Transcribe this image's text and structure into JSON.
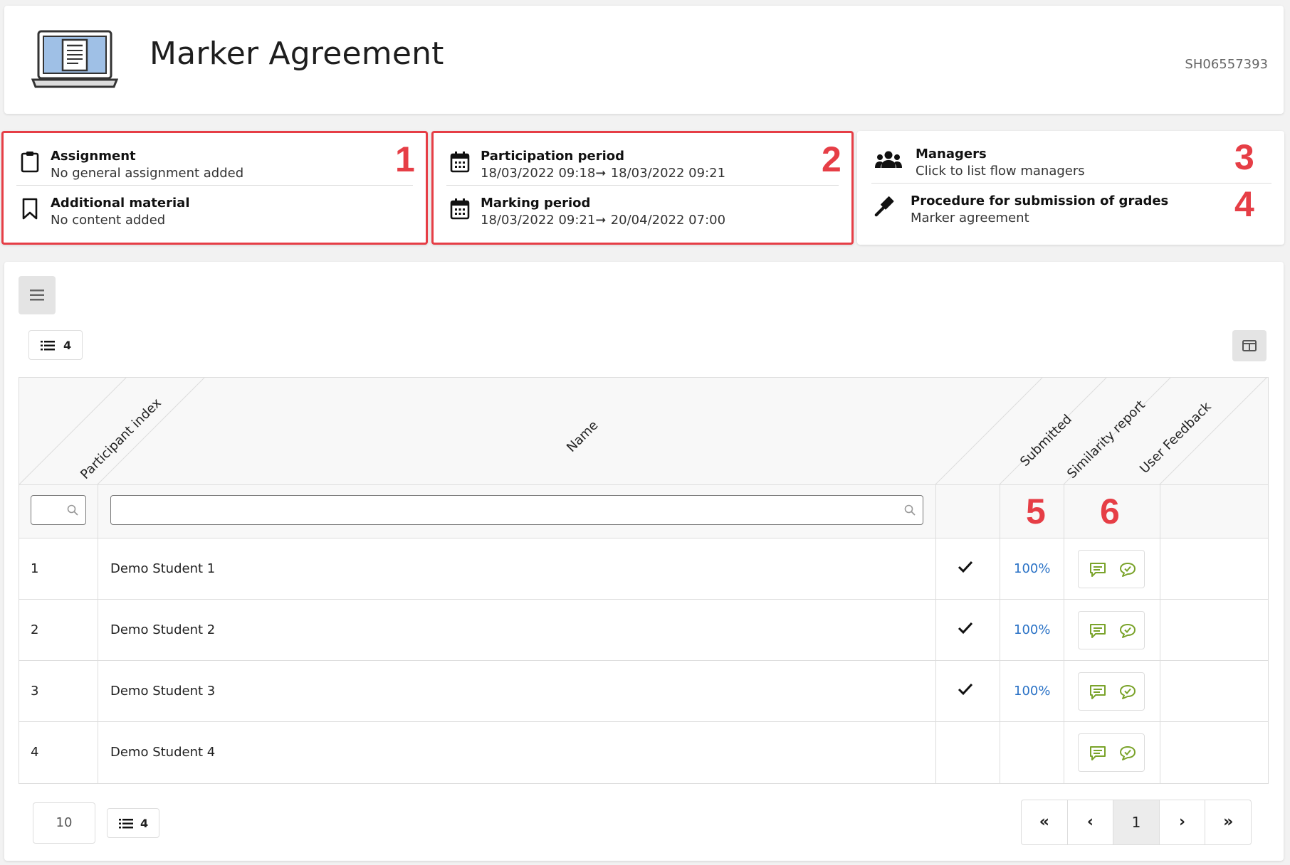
{
  "header": {
    "title": "Marker Agreement",
    "code": "SH06557393",
    "icon": "laptop-document-icon"
  },
  "info_cards": {
    "assignment": {
      "title": "Assignment",
      "subtitle": "No general assignment added",
      "icon": "clipboard-icon"
    },
    "additional_material": {
      "title": "Additional material",
      "subtitle": "No content added",
      "icon": "bookmark-icon"
    },
    "participation_period": {
      "title": "Participation period",
      "start": "18/03/2022 09:18",
      "end": "18/03/2022 09:21",
      "icon": "calendar-icon"
    },
    "marking_period": {
      "title": "Marking period",
      "start": "18/03/2022 09:21",
      "end": "20/04/2022 07:00",
      "icon": "calendar-icon"
    },
    "managers": {
      "title": "Managers",
      "subtitle": "Click to list flow managers",
      "icon": "users-icon"
    },
    "procedure": {
      "title": "Procedure for submission of grades",
      "subtitle": "Marker agreement",
      "icon": "gavel-icon"
    }
  },
  "annotations": [
    "1",
    "2",
    "3",
    "4",
    "5",
    "6"
  ],
  "toolbar": {
    "count": "4"
  },
  "table": {
    "columns": [
      "Participant index",
      "Name",
      "Submitted",
      "Similarity report",
      "User Feedback"
    ],
    "rows": [
      {
        "index": "1",
        "name": "Demo Student 1",
        "submitted": true,
        "similarity": "100%"
      },
      {
        "index": "2",
        "name": "Demo Student 2",
        "submitted": true,
        "similarity": "100%"
      },
      {
        "index": "3",
        "name": "Demo Student 3",
        "submitted": true,
        "similarity": "100%"
      },
      {
        "index": "4",
        "name": "Demo Student 4",
        "submitted": false,
        "similarity": ""
      }
    ]
  },
  "footer": {
    "page_size": "10",
    "count": "4",
    "pager": {
      "first": "«",
      "prev": "‹",
      "current": "1",
      "next": "›",
      "last": "»"
    }
  },
  "colors": {
    "annotation": "#e63e46",
    "link": "#2a72c6",
    "feedback_icon": "#7aa32a"
  }
}
